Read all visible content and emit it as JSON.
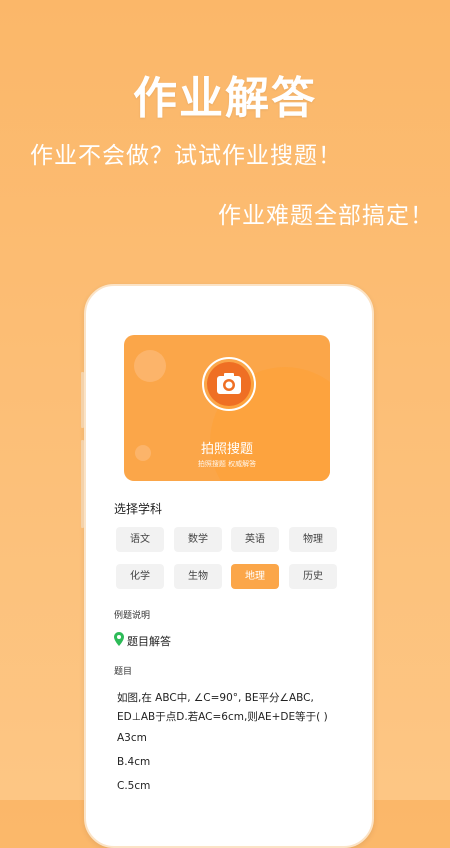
{
  "hero": {
    "title": "作业解答",
    "subtitle1": "作业不会做？试试作业搜题！",
    "subtitle2": "作业难题全部搞定！"
  },
  "card": {
    "title": "拍照搜题",
    "subtitle": "拍照搜题 权威解答",
    "icon": "camera-icon"
  },
  "subjects": {
    "title": "选择学科",
    "items": [
      "语文",
      "数学",
      "英语",
      "物理",
      "化学",
      "生物",
      "地理",
      "历史"
    ],
    "selected": "地理"
  },
  "example": {
    "title": "例题说明",
    "tag": "题目解答",
    "tag_icon": "location-pin-icon",
    "question_label": "题目",
    "question_line1": "如图,在 ABC中, ∠C=90°, BE平分∠ABC,",
    "question_line2": "ED⊥AB于点D.若AC=6cm,则AE+DE等于( )",
    "options": [
      "A3cm",
      "B.4cm",
      "C.5cm"
    ]
  },
  "colors": {
    "background": "#fbb769",
    "accent": "#fba649",
    "camera": "#ef6f24",
    "pin": "#2dbb58"
  }
}
